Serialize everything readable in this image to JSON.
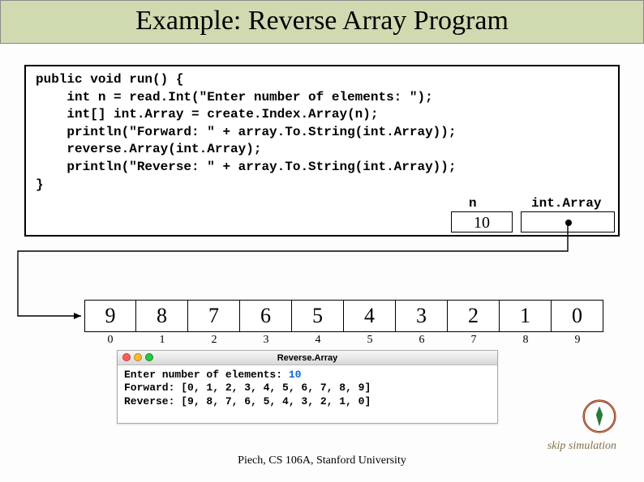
{
  "title": "Example: Reverse Array Program",
  "code": "public void run() {\n    int n = read.Int(\"Enter number of elements: \");\n    int[] int.Array = create.Index.Array(n);\n    println(\"Forward: \" + array.To.String(int.Array));\n    reverse.Array(int.Array);\n    println(\"Reverse: \" + array.To.String(int.Array));\n}",
  "vars": {
    "n_label": "n",
    "n_value": "10",
    "array_label": "int.Array"
  },
  "array": {
    "cells": [
      "9",
      "8",
      "7",
      "6",
      "5",
      "4",
      "3",
      "2",
      "1",
      "0"
    ],
    "indices": [
      "0",
      "1",
      "2",
      "3",
      "4",
      "5",
      "6",
      "7",
      "8",
      "9"
    ]
  },
  "console": {
    "title": "Reverse.Array",
    "prompt_prefix": "Enter number of elements: ",
    "prompt_value": "10",
    "forward": "Forward: [0, 1, 2, 3, 4, 5, 6, 7, 8, 9]",
    "reverse": "Reverse: [9, 8, 7, 6, 5, 4, 3, 2, 1, 0]"
  },
  "footer": "Piech, CS 106A, Stanford University",
  "skip": "skip simulation"
}
